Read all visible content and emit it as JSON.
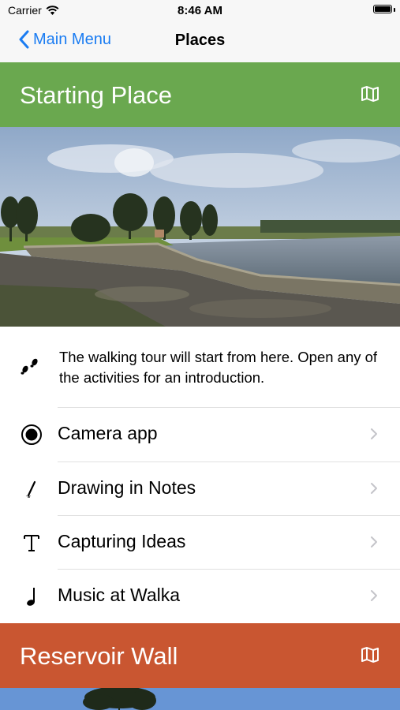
{
  "status": {
    "carrier": "Carrier",
    "time": "8:46 AM"
  },
  "nav": {
    "back_label": "Main Menu",
    "title": "Places"
  },
  "sections": [
    {
      "title": "Starting Place",
      "color": "#6aa84f",
      "description": "The walking tour will start from here. Open any of the activities for an introduction.",
      "activities": [
        {
          "label": "Camera app",
          "icon": "camera-record-icon"
        },
        {
          "label": "Drawing in Notes",
          "icon": "pencil-icon"
        },
        {
          "label": "Capturing Ideas",
          "icon": "text-t-icon"
        },
        {
          "label": "Music at Walka",
          "icon": "music-note-icon"
        }
      ]
    },
    {
      "title": "Reservoir Wall",
      "color": "#c95631"
    }
  ]
}
